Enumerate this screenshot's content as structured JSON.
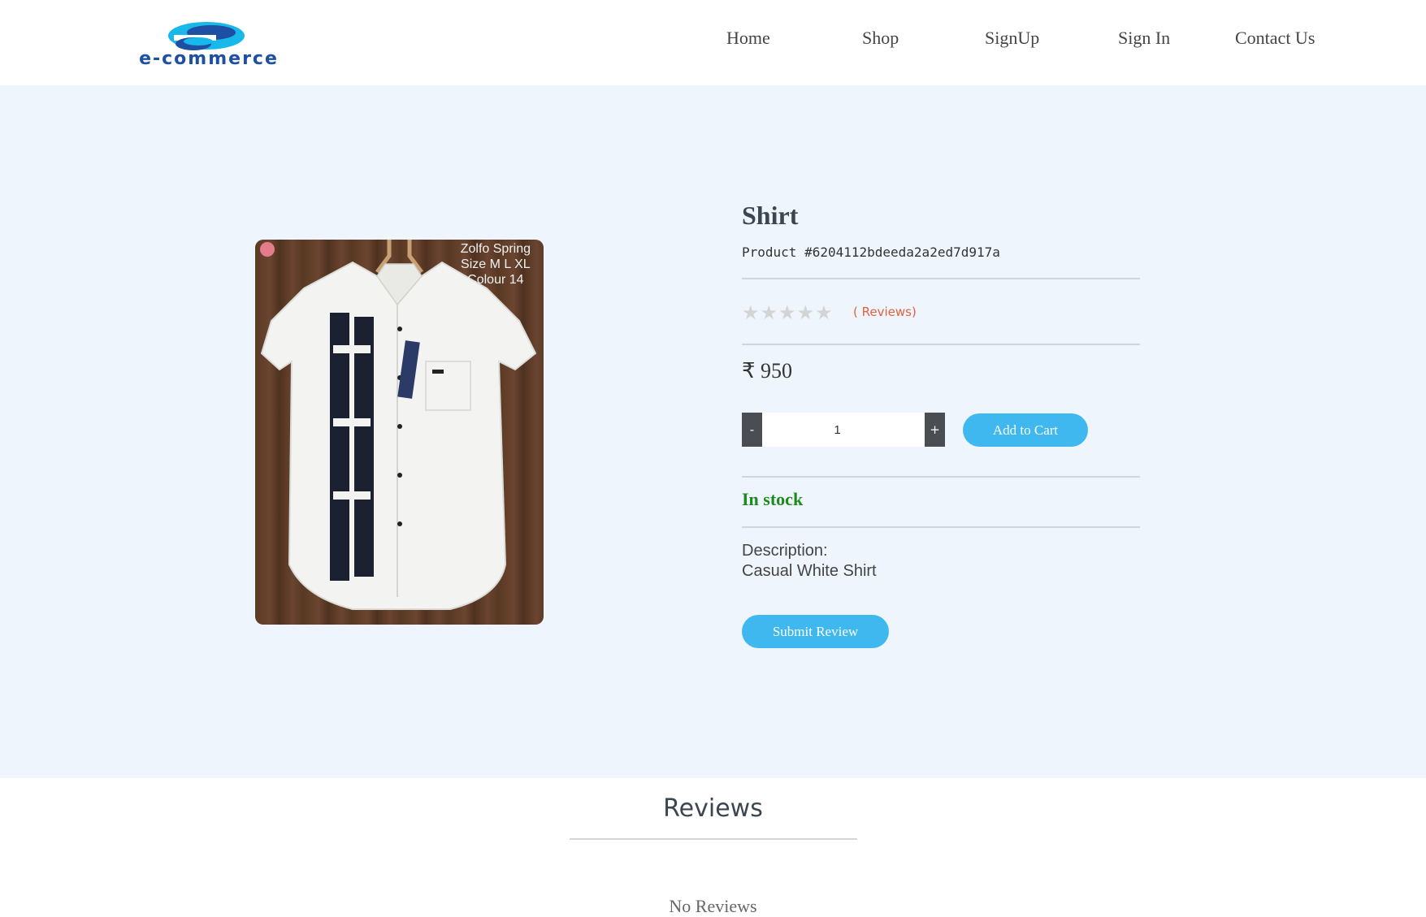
{
  "header": {
    "logo_text": "e-commerce",
    "nav": [
      "Home",
      "Shop",
      "SignUp",
      "Sign In",
      "Contact Us"
    ]
  },
  "product": {
    "image_caption": [
      "Zolfo Spring",
      "Size M L XL",
      "Colour 14"
    ],
    "title": "Shirt",
    "id_label": "Product #6204112bdeeda2a2ed7d917a",
    "stars": "★★★★★",
    "rating": 0,
    "reviews_link": "( Reviews)",
    "price": "₹ 950",
    "qty_minus": "-",
    "qty_plus": "+",
    "quantity": "1",
    "add_to_cart": "Add to Cart",
    "stock_status": "In stock",
    "description_label": "Description:",
    "description": "Casual White Shirt",
    "submit_review": "Submit Review"
  },
  "reviews": {
    "title": "Reviews",
    "empty": "No Reviews"
  },
  "colors": {
    "accent": "#3fb8f0",
    "stock": "#1e8a1e",
    "reviews_link": "#e4603f",
    "background": "#eef5fc"
  }
}
